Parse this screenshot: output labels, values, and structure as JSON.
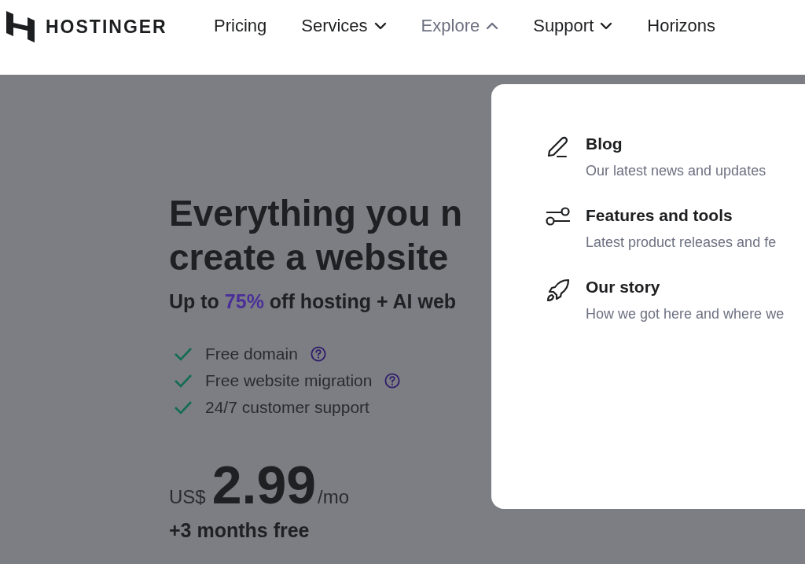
{
  "brand": {
    "name": "HOSTINGER"
  },
  "nav": [
    {
      "label": "Pricing",
      "has_menu": false,
      "expanded": false
    },
    {
      "label": "Services",
      "has_menu": true,
      "expanded": false
    },
    {
      "label": "Explore",
      "has_menu": true,
      "expanded": true
    },
    {
      "label": "Support",
      "has_menu": true,
      "expanded": false
    },
    {
      "label": "Horizons",
      "has_menu": false,
      "expanded": false
    }
  ],
  "hero": {
    "heading_lines": [
      "Everything you n",
      "create a website"
    ],
    "subtitle": {
      "before": "Up to ",
      "highlight": "75%",
      "after": " off hosting + AI web"
    },
    "features": [
      {
        "text": "Free domain",
        "has_help": true
      },
      {
        "text": "Free website migration",
        "has_help": true
      },
      {
        "text": "24/7 customer support",
        "has_help": false
      }
    ],
    "price": {
      "currency": "US$",
      "amount": "2.99",
      "period": "/mo"
    },
    "bonus": "+3 months free"
  },
  "explore_menu": [
    {
      "kind": "pen",
      "title": "Blog",
      "description": "Our latest news and updates"
    },
    {
      "kind": "toggles",
      "title": "Features and tools",
      "description": "Latest product releases and fe"
    },
    {
      "kind": "rocket",
      "title": "Our story",
      "description": "How we got here and where we"
    }
  ]
}
